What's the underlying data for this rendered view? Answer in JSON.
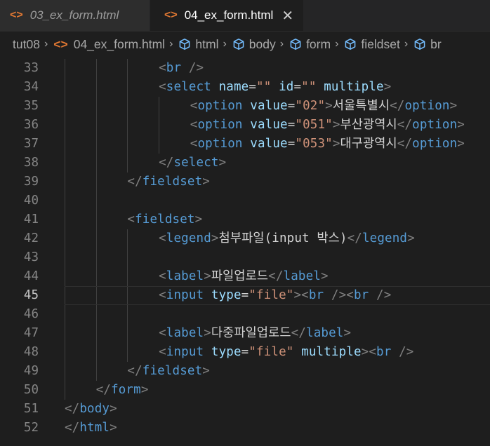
{
  "tabs": [
    {
      "label": "03_ex_form.html",
      "active": false,
      "icon": "code-brackets-icon"
    },
    {
      "label": "04_ex_form.html",
      "active": true,
      "icon": "code-brackets-icon"
    }
  ],
  "breadcrumb": [
    "tut08",
    "04_ex_form.html",
    "html",
    "body",
    "form",
    "fieldset",
    "br"
  ],
  "colors": {
    "tag_bracket": "#808080",
    "tag_name": "#569cd6",
    "attribute": "#9cdcfe",
    "string": "#ce9178",
    "text": "#d4d4d4",
    "file_icon": "#e37933",
    "symbol_icon": "#75beff"
  },
  "current_line": 45,
  "lines": [
    {
      "n": 33,
      "indent": 3,
      "tokens": [
        [
          "b",
          "<"
        ],
        [
          "n",
          "br"
        ],
        [
          "t",
          " "
        ],
        [
          "b",
          "/>"
        ]
      ]
    },
    {
      "n": 34,
      "indent": 3,
      "tokens": [
        [
          "b",
          "<"
        ],
        [
          "n",
          "select"
        ],
        [
          "t",
          " "
        ],
        [
          "a",
          "name"
        ],
        [
          "t",
          "="
        ],
        [
          "s",
          "\"\""
        ],
        [
          "t",
          " "
        ],
        [
          "a",
          "id"
        ],
        [
          "t",
          "="
        ],
        [
          "s",
          "\"\""
        ],
        [
          "t",
          " "
        ],
        [
          "a",
          "multiple"
        ],
        [
          "b",
          ">"
        ]
      ]
    },
    {
      "n": 35,
      "indent": 4,
      "tokens": [
        [
          "b",
          "<"
        ],
        [
          "n",
          "option"
        ],
        [
          "t",
          " "
        ],
        [
          "a",
          "value"
        ],
        [
          "t",
          "="
        ],
        [
          "s",
          "\"02\""
        ],
        [
          "b",
          ">"
        ],
        [
          "t",
          "서울특별시"
        ],
        [
          "b",
          "</"
        ],
        [
          "n",
          "option"
        ],
        [
          "b",
          ">"
        ]
      ]
    },
    {
      "n": 36,
      "indent": 4,
      "tokens": [
        [
          "b",
          "<"
        ],
        [
          "n",
          "option"
        ],
        [
          "t",
          " "
        ],
        [
          "a",
          "value"
        ],
        [
          "t",
          "="
        ],
        [
          "s",
          "\"051\""
        ],
        [
          "b",
          ">"
        ],
        [
          "t",
          "부산광역시"
        ],
        [
          "b",
          "</"
        ],
        [
          "n",
          "option"
        ],
        [
          "b",
          ">"
        ]
      ]
    },
    {
      "n": 37,
      "indent": 4,
      "tokens": [
        [
          "b",
          "<"
        ],
        [
          "n",
          "option"
        ],
        [
          "t",
          " "
        ],
        [
          "a",
          "value"
        ],
        [
          "t",
          "="
        ],
        [
          "s",
          "\"053\""
        ],
        [
          "b",
          ">"
        ],
        [
          "t",
          "대구광역시"
        ],
        [
          "b",
          "</"
        ],
        [
          "n",
          "option"
        ],
        [
          "b",
          ">"
        ]
      ]
    },
    {
      "n": 38,
      "indent": 3,
      "tokens": [
        [
          "b",
          "</"
        ],
        [
          "n",
          "select"
        ],
        [
          "b",
          ">"
        ]
      ]
    },
    {
      "n": 39,
      "indent": 2,
      "tokens": [
        [
          "b",
          "</"
        ],
        [
          "n",
          "fieldset"
        ],
        [
          "b",
          ">"
        ]
      ]
    },
    {
      "n": 40,
      "indent": 0,
      "tokens": []
    },
    {
      "n": 41,
      "indent": 2,
      "tokens": [
        [
          "b",
          "<"
        ],
        [
          "n",
          "fieldset"
        ],
        [
          "b",
          ">"
        ]
      ]
    },
    {
      "n": 42,
      "indent": 3,
      "tokens": [
        [
          "b",
          "<"
        ],
        [
          "n",
          "legend"
        ],
        [
          "b",
          ">"
        ],
        [
          "t",
          "첨부파일(input 박스)"
        ],
        [
          "b",
          "</"
        ],
        [
          "n",
          "legend"
        ],
        [
          "b",
          ">"
        ]
      ]
    },
    {
      "n": 43,
      "indent": 0,
      "tokens": []
    },
    {
      "n": 44,
      "indent": 3,
      "tokens": [
        [
          "b",
          "<"
        ],
        [
          "n",
          "label"
        ],
        [
          "b",
          ">"
        ],
        [
          "t",
          "파일업로드"
        ],
        [
          "b",
          "</"
        ],
        [
          "n",
          "label"
        ],
        [
          "b",
          ">"
        ]
      ]
    },
    {
      "n": 45,
      "indent": 3,
      "tokens": [
        [
          "b",
          "<"
        ],
        [
          "n",
          "input"
        ],
        [
          "t",
          " "
        ],
        [
          "a",
          "type"
        ],
        [
          "t",
          "="
        ],
        [
          "s",
          "\"file\""
        ],
        [
          "b",
          ">"
        ],
        [
          "b",
          "<"
        ],
        [
          "n",
          "br"
        ],
        [
          "t",
          " "
        ],
        [
          "b",
          "/>"
        ],
        [
          "b",
          "<"
        ],
        [
          "n",
          "br"
        ],
        [
          "t",
          " "
        ],
        [
          "b",
          "/>"
        ]
      ]
    },
    {
      "n": 46,
      "indent": 0,
      "tokens": []
    },
    {
      "n": 47,
      "indent": 3,
      "tokens": [
        [
          "b",
          "<"
        ],
        [
          "n",
          "label"
        ],
        [
          "b",
          ">"
        ],
        [
          "t",
          "다중파일업로드"
        ],
        [
          "b",
          "</"
        ],
        [
          "n",
          "label"
        ],
        [
          "b",
          ">"
        ]
      ]
    },
    {
      "n": 48,
      "indent": 3,
      "tokens": [
        [
          "b",
          "<"
        ],
        [
          "n",
          "input"
        ],
        [
          "t",
          " "
        ],
        [
          "a",
          "type"
        ],
        [
          "t",
          "="
        ],
        [
          "s",
          "\"file\""
        ],
        [
          "t",
          " "
        ],
        [
          "a",
          "multiple"
        ],
        [
          "b",
          ">"
        ],
        [
          "b",
          "<"
        ],
        [
          "n",
          "br"
        ],
        [
          "t",
          " "
        ],
        [
          "b",
          "/>"
        ]
      ]
    },
    {
      "n": 49,
      "indent": 2,
      "tokens": [
        [
          "b",
          "</"
        ],
        [
          "n",
          "fieldset"
        ],
        [
          "b",
          ">"
        ]
      ]
    },
    {
      "n": 50,
      "indent": 1,
      "tokens": [
        [
          "b",
          "</"
        ],
        [
          "n",
          "form"
        ],
        [
          "b",
          ">"
        ]
      ]
    },
    {
      "n": 51,
      "indent": 0,
      "tokens": [
        [
          "b",
          "</"
        ],
        [
          "n",
          "body"
        ],
        [
          "b",
          ">"
        ]
      ]
    },
    {
      "n": 52,
      "indent": 0,
      "tokens": [
        [
          "b",
          "</"
        ],
        [
          "n",
          "html"
        ],
        [
          "b",
          ">"
        ]
      ]
    }
  ]
}
